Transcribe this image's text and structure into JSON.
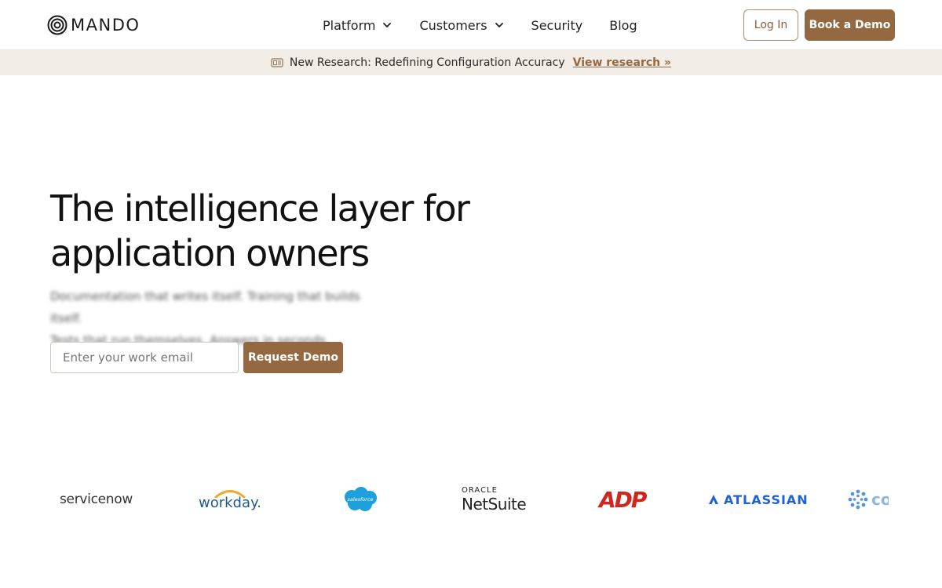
{
  "brand": {
    "name": "MANDO"
  },
  "nav": {
    "items": [
      {
        "label": "Platform",
        "has_dropdown": true
      },
      {
        "label": "Customers",
        "has_dropdown": true
      },
      {
        "label": "Security",
        "has_dropdown": false
      },
      {
        "label": "Blog",
        "has_dropdown": false
      }
    ],
    "login_label": "Log In",
    "demo_label": "Book a Demo"
  },
  "banner": {
    "icon": "newspaper-icon",
    "text": "New Research: Redefining Configuration Accuracy",
    "link_label": "View research »"
  },
  "hero": {
    "title_line1": "The intelligence layer for",
    "title_line2": "application owners",
    "subtitle_line1": "Documentation that writes itself. Training that builds itself.",
    "subtitle_line2": "Tests that run themselves. Answers in seconds.",
    "email_placeholder": "Enter your work email",
    "cta_label": "Request Demo"
  },
  "customer_logos": {
    "servicenow": "servicenow",
    "workday": "workday.",
    "salesforce": "salesforce",
    "oracle": "ORACLE",
    "netsuite": "NetSuite",
    "adp": "ADP",
    "atlassian": "ATLASSIAN",
    "coupa": "co"
  },
  "colors": {
    "accent": "#946840",
    "banner_bg": "#f3ede7",
    "text": "#111111",
    "atlassian": "#1d63d6",
    "adp": "#d0271d",
    "salesforce": "#1ea0dd",
    "workday_blue": "#1e5a8f",
    "workday_orange": "#f5a623"
  }
}
